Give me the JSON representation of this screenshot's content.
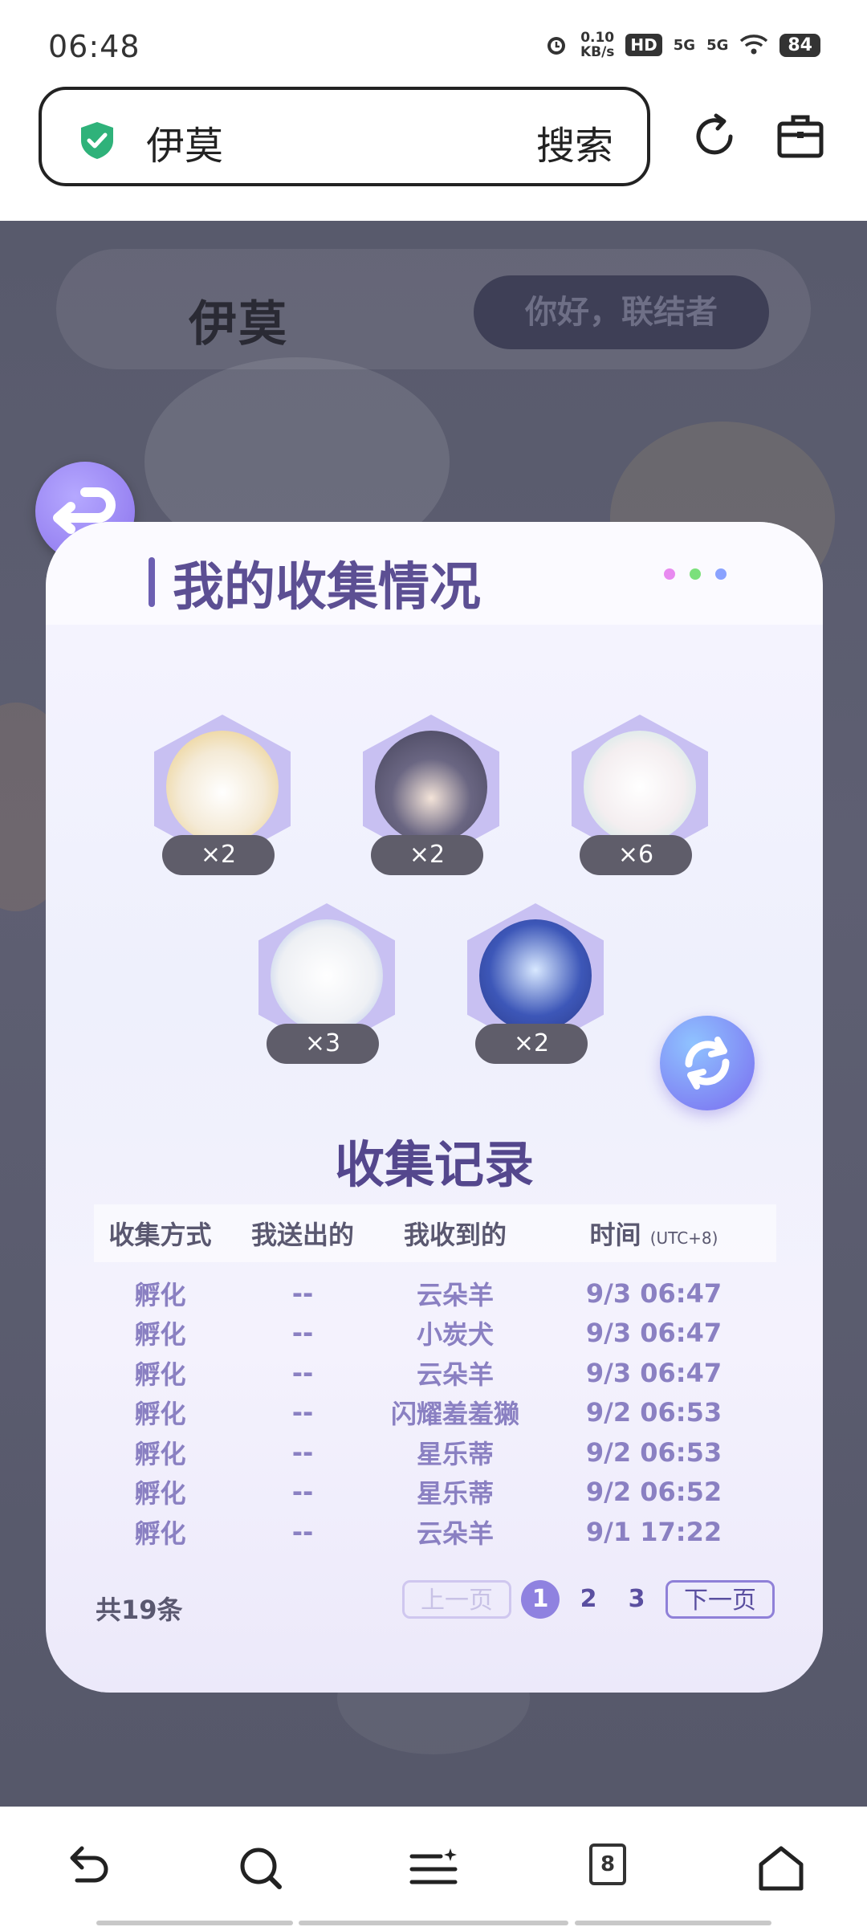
{
  "status": {
    "time": "06:48",
    "speed_value": "0.10",
    "speed_unit": "KB/s",
    "hd": "HD",
    "net1": "5G",
    "net2": "5G",
    "battery": "84"
  },
  "browser": {
    "search_text": "伊莫",
    "search_button": "搜索"
  },
  "site": {
    "logo": "伊莫",
    "greeting": "你好，联结者"
  },
  "panel": {
    "title": "我的收集情况",
    "pets": [
      {
        "count": "×2"
      },
      {
        "count": "×2"
      },
      {
        "count": "×6"
      },
      {
        "count": "×3"
      },
      {
        "count": "×2"
      }
    ],
    "records_title": "收集记录",
    "columns": {
      "method": "收集方式",
      "sent": "我送出的",
      "received": "我收到的",
      "time": "时间",
      "time_unit": "(UTC+8)"
    },
    "rows": [
      {
        "method": "孵化",
        "sent": "--",
        "received": "云朵羊",
        "time": "9/3 06:47"
      },
      {
        "method": "孵化",
        "sent": "--",
        "received": "小炭犬",
        "time": "9/3 06:47"
      },
      {
        "method": "孵化",
        "sent": "--",
        "received": "云朵羊",
        "time": "9/3 06:47"
      },
      {
        "method": "孵化",
        "sent": "--",
        "received": "闪耀羞羞獭",
        "time": "9/2 06:53"
      },
      {
        "method": "孵化",
        "sent": "--",
        "received": "星乐蒂",
        "time": "9/2 06:53"
      },
      {
        "method": "孵化",
        "sent": "--",
        "received": "星乐蒂",
        "time": "9/2 06:52"
      },
      {
        "method": "孵化",
        "sent": "--",
        "received": "云朵羊",
        "time": "9/1 17:22"
      }
    ],
    "total": "共19条",
    "pager": {
      "prev": "上一页",
      "pages": [
        "1",
        "2",
        "3"
      ],
      "next": "下一页"
    }
  },
  "nav": {
    "tabs_count": "8"
  },
  "colors": {
    "accent": "#8f82e0",
    "title": "#5c4f93",
    "row_text": "#8a80c2"
  }
}
